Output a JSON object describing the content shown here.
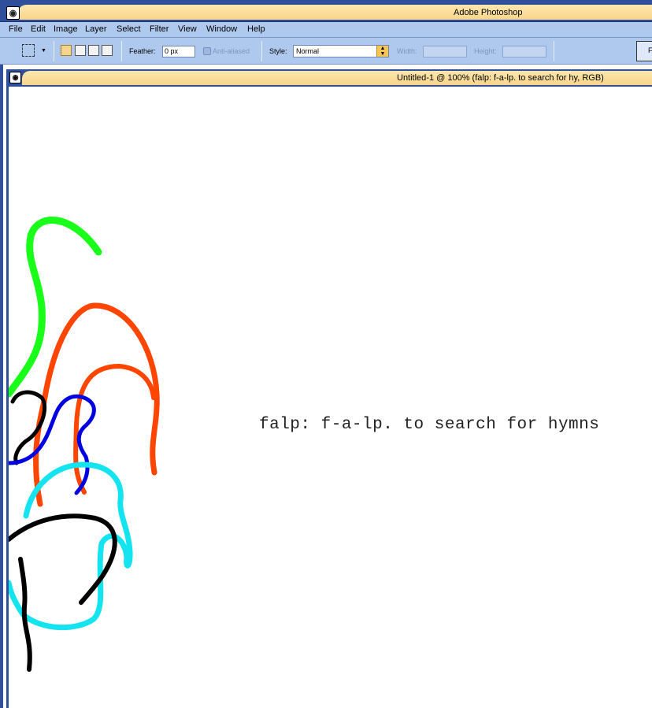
{
  "window": {
    "title": "Adobe Photoshop",
    "icon": "photoshop-eye-icon"
  },
  "menu": {
    "items": [
      "File",
      "Edit",
      "Image",
      "Layer",
      "Select",
      "Filter",
      "View",
      "Window",
      "Help"
    ]
  },
  "options": {
    "tool_icon": "rectangular-marquee-icon",
    "feather_label": "Feather:",
    "feather_value": "0 px",
    "anti_aliased_label": "Anti-aliased",
    "style_label": "Style:",
    "style_value": "Normal",
    "width_label": "Width:",
    "height_label": "Height:",
    "palette_well_glyph": "F"
  },
  "document": {
    "title": "Untitled-1 @ 100% (falp: f-a-lp. to search for hy, RGB)",
    "canvas_text": "falp: f-a-lp. to search for hymns"
  },
  "colors": {
    "frame_blue": "#2f4f9a",
    "bar_blue": "#aec8ee",
    "title_peach": "#f8d58a",
    "stroke_green": "#1aff1a",
    "stroke_orange": "#ff4500",
    "stroke_blue": "#0000e0",
    "stroke_cyan": "#14e3f0",
    "stroke_black": "#000000"
  }
}
